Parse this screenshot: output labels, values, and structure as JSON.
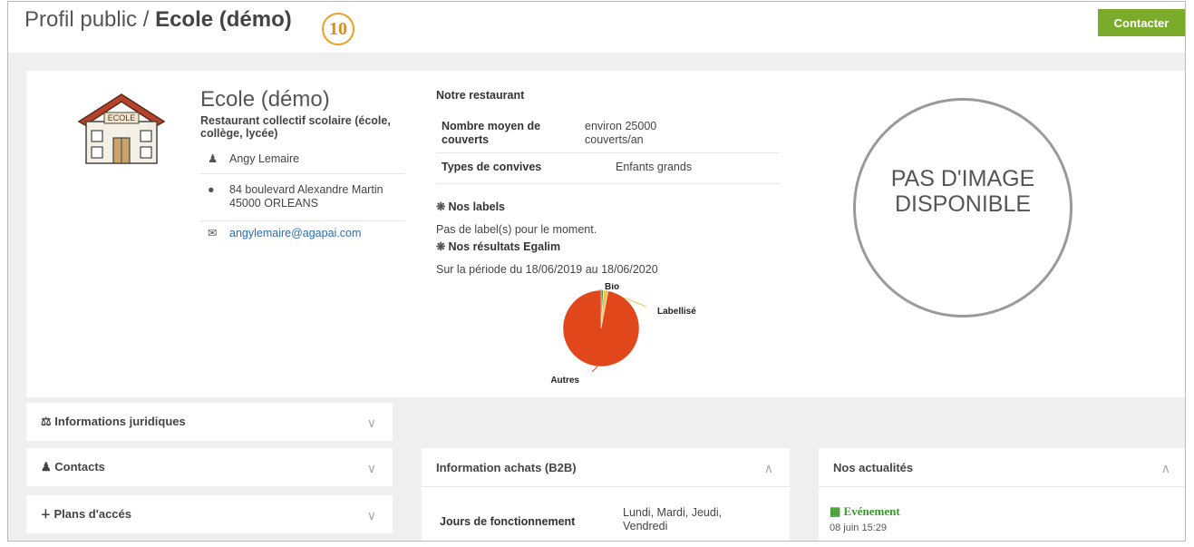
{
  "header": {
    "breadcrumb_prefix": "Profil public / ",
    "breadcrumb_current": "Ecole (démo)",
    "step_number": "10",
    "contact_label": "Contacter"
  },
  "profile": {
    "name": "Ecole (démo)",
    "type": "Restaurant collectif scolaire (école, collège, lycée)",
    "contact_name": "Angy Lemaire",
    "address": "84 boulevard Alexandre Martin 45000 ORLEANS",
    "email": "angylemaire@agapai.com",
    "logo_sign": "ECOLE"
  },
  "restaurant": {
    "title": "Notre restaurant",
    "rows": [
      {
        "key": "Nombre moyen de couverts",
        "value": "environ 25000 couverts/an"
      },
      {
        "key": "Types de convives",
        "value": "Enfants grands"
      }
    ]
  },
  "labels": {
    "title": "Nos labels",
    "empty_text": "Pas de label(s) pour le moment."
  },
  "egalim": {
    "title": "Nos résultats Egalim",
    "period": "Sur la période du 18/06/2019 au 18/06/2020"
  },
  "chart_data": {
    "type": "pie",
    "slices": [
      {
        "label": "Bio",
        "value": 1,
        "color": "#3a9a4a"
      },
      {
        "label": "Labellisé",
        "value": 2,
        "color": "#f2c14e"
      },
      {
        "label": "Autres",
        "value": 97,
        "color": "#e0481c"
      }
    ]
  },
  "no_image": {
    "line1": "PAS D'IMAGE",
    "line2": "DISPONIBLE"
  },
  "accordions": {
    "legal": "Informations juridiques",
    "contacts": "Contacts",
    "access": "Plans d'accés"
  },
  "b2b": {
    "title": "Information achats (B2B)",
    "days_label": "Jours de fonctionnement",
    "days_value": "Lundi, Mardi, Jeudi, Vendredi"
  },
  "news": {
    "title": "Nos actualités",
    "event_type": "Evénement",
    "event_date": "08 juin 15:29"
  },
  "icons": [
    "user-icon",
    "map-marker-icon",
    "envelope-icon",
    "gear-icon",
    "balance-icon",
    "users-icon",
    "signpost-icon",
    "chevron-down-icon",
    "chevron-up-icon",
    "calendar-icon"
  ],
  "colors": {
    "accent_green": "#7aab2a",
    "badge_orange": "#f0a020",
    "link_blue": "#2a6db5",
    "event_green": "#3a9a2a"
  }
}
